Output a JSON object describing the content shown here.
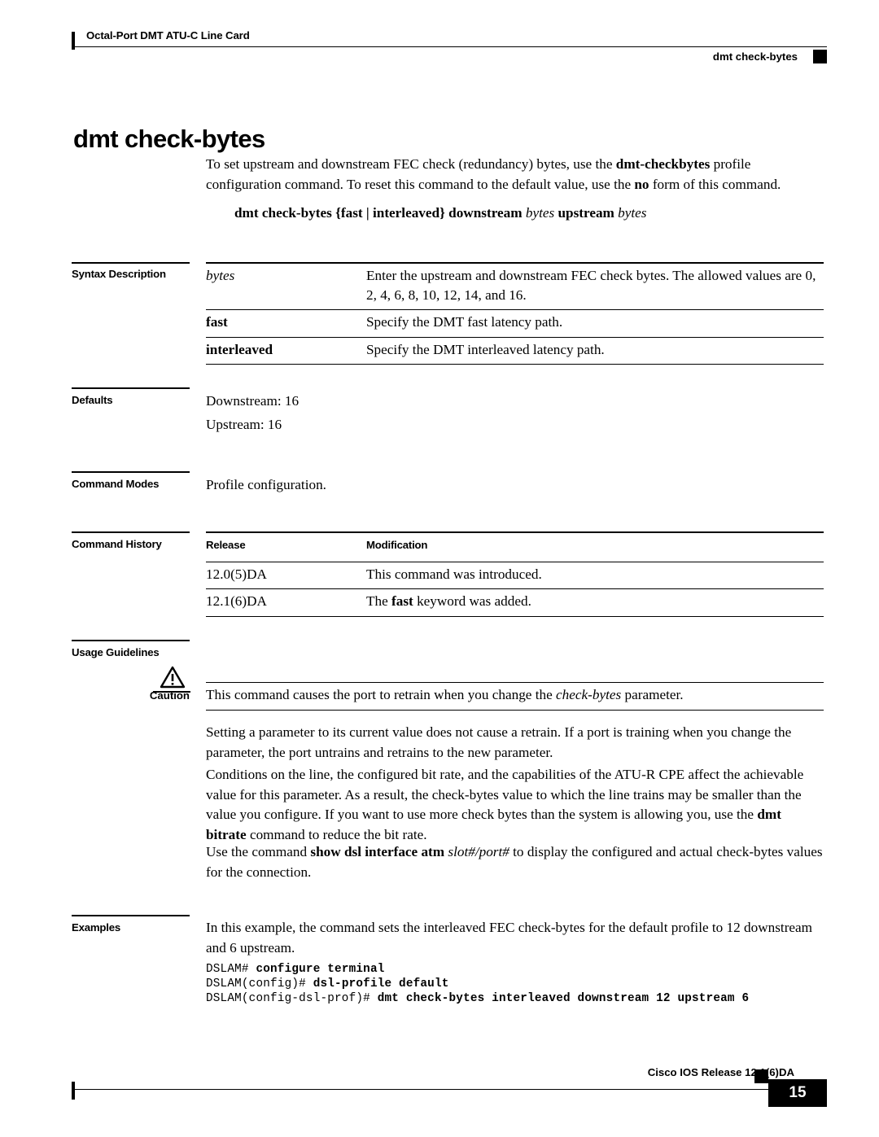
{
  "header": {
    "left": "Octal-Port DMT ATU-C Line Card",
    "right": "dmt check-bytes"
  },
  "title": "dmt check-bytes",
  "intro": {
    "p1_a": "To set upstream and downstream FEC check (redundancy) bytes, use the ",
    "p1_b": "dmt-checkbytes",
    "p1_c": " profile configuration command. To reset this command to the default value, use the ",
    "p1_d": "no",
    "p1_e": " form of this command.",
    "syntax_a": "dmt check-bytes {fast | interleaved} downstream ",
    "syntax_b": "bytes",
    "syntax_c": " upstream ",
    "syntax_d": "bytes"
  },
  "sections": {
    "syntax_description": {
      "label": "Syntax Description",
      "rows": [
        {
          "term": "bytes",
          "term_style": "italic",
          "desc": "Enter the upstream and downstream FEC check bytes. The allowed values are 0, 2, 4, 6, 8, 10, 12, 14, and 16."
        },
        {
          "term": "fast",
          "term_style": "bold",
          "desc": "Specify the DMT fast latency path."
        },
        {
          "term": "interleaved",
          "term_style": "bold",
          "desc": "Specify the DMT interleaved latency path."
        }
      ]
    },
    "defaults": {
      "label": "Defaults",
      "line1": "Downstream: 16",
      "line2": "Upstream: 16"
    },
    "command_modes": {
      "label": "Command Modes",
      "text": "Profile configuration."
    },
    "command_history": {
      "label": "Command History",
      "columns": [
        "Release",
        "Modification"
      ],
      "rows": [
        {
          "release": "12.0(5)DA",
          "mod_a": "This command was introduced.",
          "mod_b": "",
          "mod_c": ""
        },
        {
          "release": "12.1(6)DA",
          "mod_a": "The ",
          "mod_b": "fast",
          "mod_c": " keyword was added."
        }
      ]
    },
    "usage_guidelines": {
      "label": "Usage Guidelines",
      "caution_label": "Caution",
      "caution_a": "This command causes the port to retrain when you change the ",
      "caution_b": "check-bytes",
      "caution_c": " parameter.",
      "p1": "Setting a parameter to its current value does not cause a retrain. If a port is training when you change the parameter, the port untrains and retrains to the new parameter.",
      "p2_a": "Conditions on the line, the configured bit rate, and the capabilities of the ATU-R CPE affect the achievable value for this parameter. As a result, the check-bytes value to which the line trains may be smaller than the value you configure. If you want to use more check bytes than the system is allowing you, use the ",
      "p2_b": "dmt bitrate",
      "p2_c": " command to reduce the bit rate.",
      "p3_a": "Use the command ",
      "p3_b": "show dsl interface atm",
      "p3_c": " ",
      "p3_d": "slot#/port#",
      "p3_e": " to display the configured and actual check-bytes values for the connection."
    },
    "examples": {
      "label": "Examples",
      "intro": "In this example, the command sets the interleaved FEC check-bytes for the default profile to 12 downstream and 6 upstream.",
      "code_lines": [
        {
          "prompt": "DSLAM# ",
          "cmd": "configure terminal"
        },
        {
          "prompt": "DSLAM(config)# ",
          "cmd": "dsl-profile default"
        },
        {
          "prompt": "DSLAM(config-dsl-prof)# ",
          "cmd": "dmt check-bytes interleaved downstream 12 upstream 6"
        }
      ]
    }
  },
  "footer": {
    "text": "Cisco IOS Release 12.1(6)DA",
    "page": "15"
  },
  "icons": {
    "caution": "caution-triangle-icon"
  },
  "colors": {
    "ink": "#000000",
    "paper": "#ffffff"
  }
}
